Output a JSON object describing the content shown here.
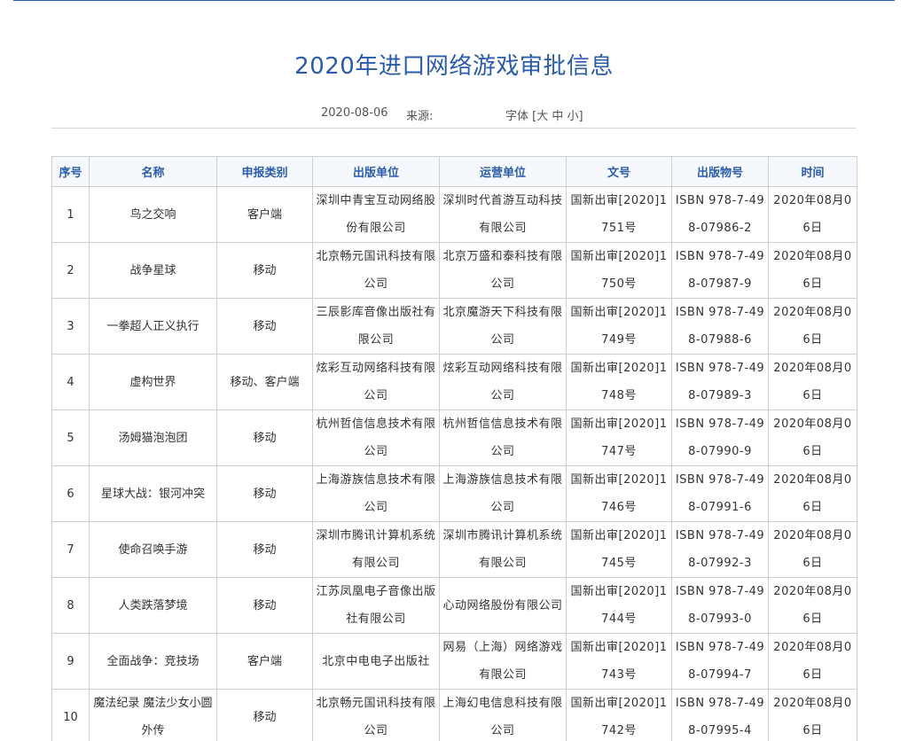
{
  "article": {
    "title": "2020年进口网络游戏审批信息",
    "date": "2020-08-06",
    "source_label": "来源:",
    "font_label": "字体 [",
    "font_large": "大",
    "font_medium": "中",
    "font_small": "小",
    "font_close": "]"
  },
  "table": {
    "headers": [
      "序号",
      "名称",
      "申报类别",
      "出版单位",
      "运营单位",
      "文号",
      "出版物号",
      "时间"
    ],
    "rows": [
      [
        "1",
        "鸟之交响",
        "客户端",
        "深圳中青宝互动网络股份有限公司",
        "深圳时代首游互动科技有限公司",
        "国新出审[2020]1751号",
        "ISBN 978-7-498-07986-2",
        "2020年08月06日"
      ],
      [
        "2",
        "战争星球",
        "移动",
        "北京畅元国讯科技有限公司",
        "北京万盛和泰科技有限公司",
        "国新出审[2020]1750号",
        "ISBN 978-7-498-07987-9",
        "2020年08月06日"
      ],
      [
        "3",
        "一拳超人正义执行",
        "移动",
        "三辰影库音像出版社有限公司",
        "北京魔游天下科技有限公司",
        "国新出审[2020]1749号",
        "ISBN 978-7-498-07988-6",
        "2020年08月06日"
      ],
      [
        "4",
        "虚构世界",
        "移动、客户端",
        "炫彩互动网络科技有限公司",
        "炫彩互动网络科技有限公司",
        "国新出审[2020]1748号",
        "ISBN 978-7-498-07989-3",
        "2020年08月06日"
      ],
      [
        "5",
        "汤姆猫泡泡团",
        "移动",
        "杭州哲信信息技术有限公司",
        "杭州哲信信息技术有限公司",
        "国新出审[2020]1747号",
        "ISBN 978-7-498-07990-9",
        "2020年08月06日"
      ],
      [
        "6",
        "星球大战：银河冲突",
        "移动",
        "上海游族信息技术有限公司",
        "上海游族信息技术有限公司",
        "国新出审[2020]1746号",
        "ISBN 978-7-498-07991-6",
        "2020年08月06日"
      ],
      [
        "7",
        "使命召唤手游",
        "移动",
        "深圳市腾讯计算机系统有限公司",
        "深圳市腾讯计算机系统有限公司",
        "国新出审[2020]1745号",
        "ISBN 978-7-498-07992-3",
        "2020年08月06日"
      ],
      [
        "8",
        "人类跌落梦境",
        "移动",
        "江苏凤凰电子音像出版社有限公司",
        "心动网络股份有限公司",
        "国新出审[2020]1744号",
        "ISBN 978-7-498-07993-0",
        "2020年08月06日"
      ],
      [
        "9",
        "全面战争：竞技场",
        "客户端",
        "北京中电电子出版社",
        "网易（上海）网络游戏有限公司",
        "国新出审[2020]1743号",
        "ISBN 978-7-498-07994-7",
        "2020年08月06日"
      ],
      [
        "10",
        "魔法纪录 魔法少女小圆外传",
        "移动",
        "北京畅元国讯科技有限公司",
        "上海幻电信息科技有限公司",
        "国新出审[2020]1742号",
        "ISBN 978-7-498-07995-4",
        "2020年08月06日"
      ]
    ]
  }
}
